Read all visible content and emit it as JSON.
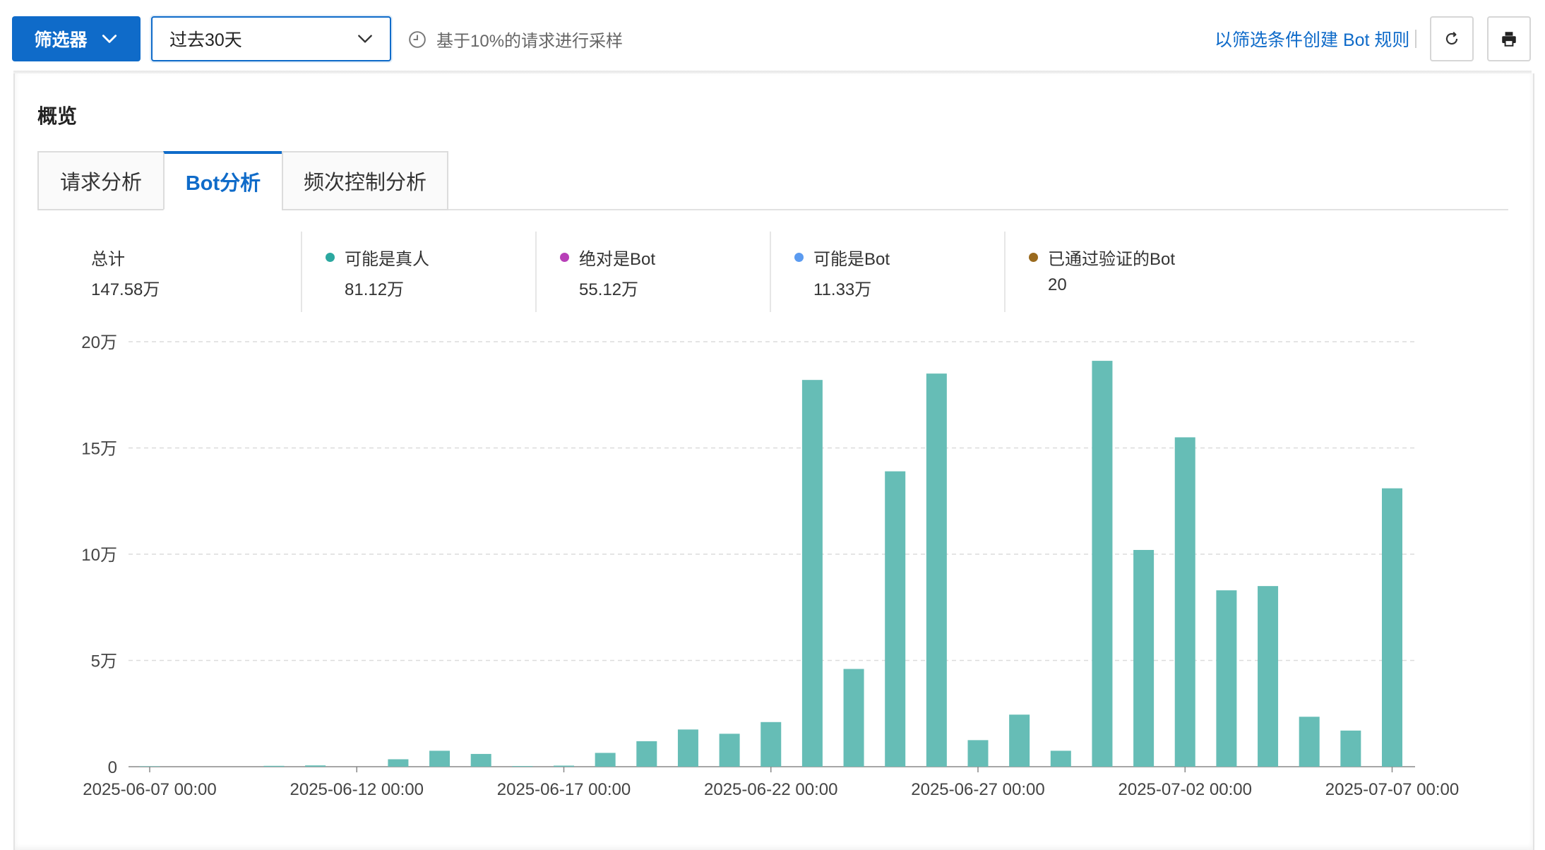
{
  "toolbar": {
    "filter_label": "筛选器",
    "date_range": "过去30天",
    "sampling_note": "基于10%的请求进行采样",
    "create_rule_link": "以筛选条件创建 Bot 规则",
    "refresh_icon": "refresh-icon",
    "print_icon": "print-icon",
    "primary_color": "#0f6bc9"
  },
  "overview": {
    "title": "概览",
    "tabs": [
      {
        "label": "请求分析",
        "active": false
      },
      {
        "label": "Bot分析",
        "active": true
      },
      {
        "label": "频次控制分析",
        "active": false
      }
    ]
  },
  "stats": [
    {
      "label": "总计",
      "value": "147.58万",
      "color": ""
    },
    {
      "label": "可能是真人",
      "value": "81.12万",
      "color": "#2ba8a0"
    },
    {
      "label": "绝对是Bot",
      "value": "55.12万",
      "color": "#b83fb8"
    },
    {
      "label": "可能是Bot",
      "value": "11.33万",
      "color": "#5b9bf0"
    },
    {
      "label": "已通过验证的Bot",
      "value": "20",
      "color": "#9a6a1e"
    }
  ],
  "chart_data": {
    "type": "bar",
    "bar_color": "#66bdb6",
    "y_ticks": [
      "0",
      "5万",
      "10万",
      "15万",
      "20万"
    ],
    "ylim": [
      0,
      200000
    ],
    "x_ticks": [
      "2025-06-07 00:00",
      "2025-06-12 00:00",
      "2025-06-17 00:00",
      "2025-06-22 00:00",
      "2025-06-27 00:00",
      "2025-07-02 00:00",
      "2025-07-07 00:00"
    ],
    "grid": true,
    "categories": [
      "2025-06-07",
      "2025-06-08",
      "2025-06-09",
      "2025-06-10",
      "2025-06-11",
      "2025-06-12",
      "2025-06-13",
      "2025-06-14",
      "2025-06-15",
      "2025-06-16",
      "2025-06-17",
      "2025-06-18",
      "2025-06-19",
      "2025-06-20",
      "2025-06-21",
      "2025-06-22",
      "2025-06-23",
      "2025-06-24",
      "2025-06-25",
      "2025-06-26",
      "2025-06-27",
      "2025-06-28",
      "2025-06-29",
      "2025-06-30",
      "2025-07-01",
      "2025-07-02",
      "2025-07-03",
      "2025-07-04",
      "2025-07-05",
      "2025-07-06",
      "2025-07-07"
    ],
    "values": [
      200,
      0,
      0,
      400,
      600,
      0,
      3500,
      7500,
      6000,
      300,
      500,
      6500,
      12000,
      17500,
      15500,
      21000,
      182000,
      46000,
      139000,
      185000,
      12500,
      24500,
      7500,
      191000,
      102000,
      155000,
      83000,
      85000,
      23500,
      17000,
      131000
    ]
  }
}
